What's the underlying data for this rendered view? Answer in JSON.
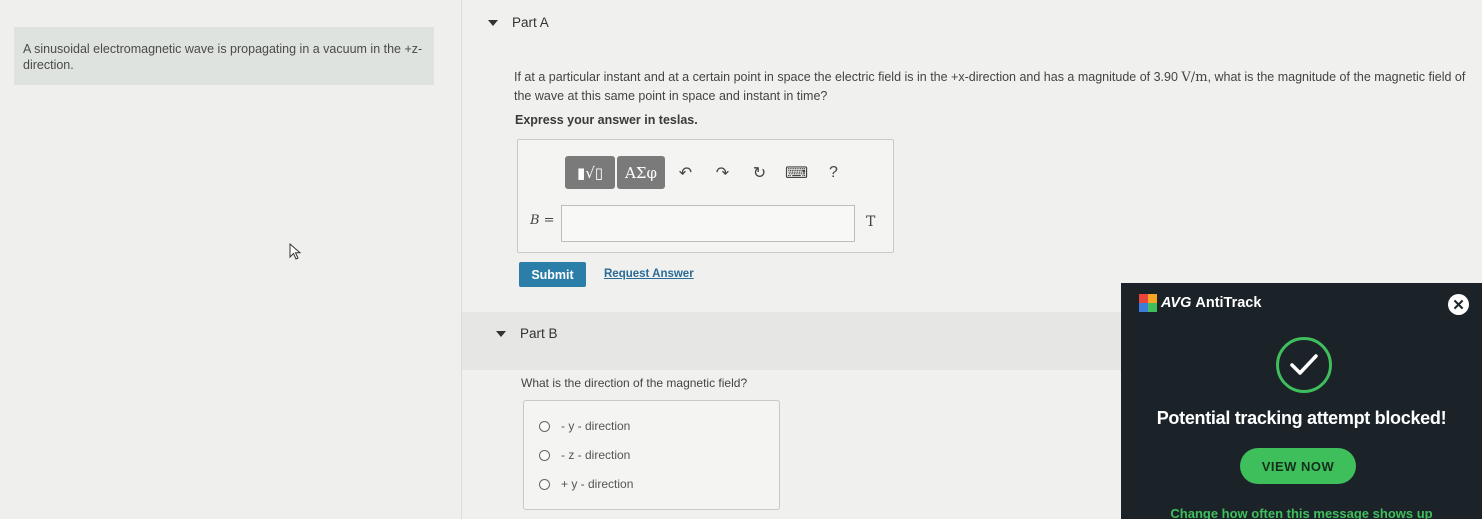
{
  "intro": {
    "text": "A sinusoidal electromagnetic wave is propagating in a vacuum in the +z-direction."
  },
  "partA": {
    "title": "Part A",
    "question_before": "If at a particular instant and at a certain point in space the electric field is in the +x-direction and has a magnitude of 3.90 ",
    "question_units": "V/m",
    "question_after": ", what is the magnitude of the magnetic field of the wave at this same point in space and instant in time?",
    "express": "Express your answer in teslas.",
    "toolbar": {
      "templates_label": "▮√▯",
      "greek_label": "ΑΣφ",
      "undo_icon": "↶",
      "redo_icon": "↷",
      "reset_icon": "↻",
      "keyboard_icon": "⌨",
      "help_label": "?"
    },
    "variable_label": "B =",
    "input_value": "",
    "unit": "T",
    "submit_label": "Submit",
    "request_label": "Request Answer"
  },
  "partB": {
    "title": "Part B",
    "question": "What is the direction of the magnetic field?",
    "options": [
      "- y - direction",
      "- z - direction",
      "+ y - direction"
    ]
  },
  "avg": {
    "brand": "AVG",
    "product": "AntiTrack",
    "close_icon": "✕",
    "message": "Potential tracking attempt blocked!",
    "view_label": "VIEW NOW",
    "change_label": "Change how often this message shows up",
    "colors": {
      "background": "#1b2329",
      "accent": "#3fbf5c"
    }
  }
}
